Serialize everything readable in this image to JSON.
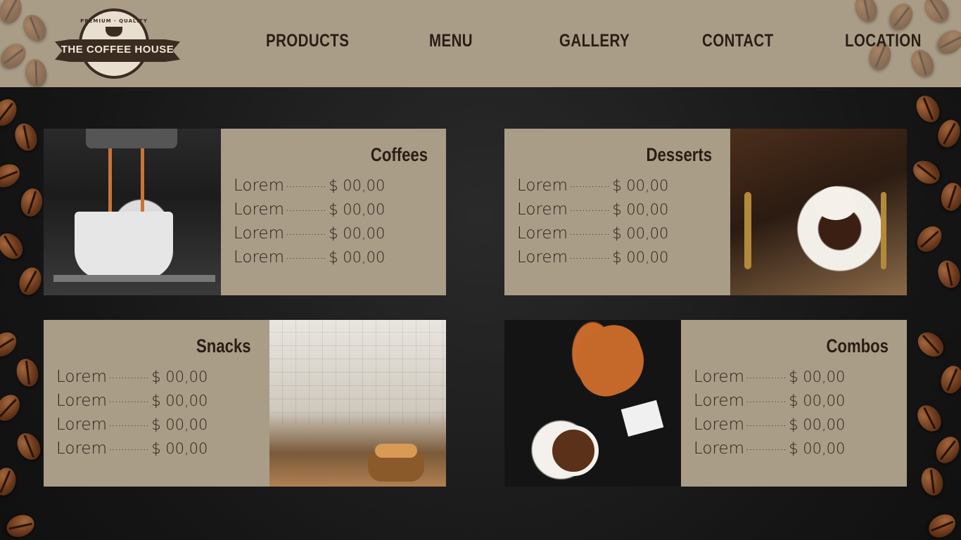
{
  "header": {
    "logo": {
      "small_text": "PREMIUM · QUALITY",
      "name": "THE COFFEE HOUSE"
    },
    "nav": [
      "PRODUCTS",
      "MENU",
      "GALLERY",
      "CONTACT",
      "LOCATION"
    ]
  },
  "cards": [
    {
      "title": "Coffees",
      "image": "espresso-machine-cup-image",
      "items": [
        {
          "name": "Lorem",
          "dots": "·············",
          "price": "$ 00,00"
        },
        {
          "name": "Lorem",
          "dots": "·············",
          "price": "$ 00,00"
        },
        {
          "name": "Lorem",
          "dots": "·············",
          "price": "$ 00,00"
        },
        {
          "name": "Lorem",
          "dots": "·············",
          "price": "$ 00,00"
        }
      ]
    },
    {
      "title": "Desserts",
      "image": "chocolate-dessert-image",
      "items": [
        {
          "name": "Lorem",
          "dots": "·············",
          "price": "$ 00,00"
        },
        {
          "name": "Lorem",
          "dots": "·············",
          "price": "$ 00,00"
        },
        {
          "name": "Lorem",
          "dots": "·············",
          "price": "$ 00,00"
        },
        {
          "name": "Lorem",
          "dots": "·············",
          "price": "$ 00,00"
        }
      ]
    },
    {
      "title": "Snacks",
      "image": "bakery-counter-image",
      "items": [
        {
          "name": "Lorem",
          "dots": "·············",
          "price": "$ 00,00"
        },
        {
          "name": "Lorem",
          "dots": "·············",
          "price": "$ 00,00"
        },
        {
          "name": "Lorem",
          "dots": "·············",
          "price": "$ 00,00"
        },
        {
          "name": "Lorem",
          "dots": "·············",
          "price": "$ 00,00"
        }
      ]
    },
    {
      "title": "Combos",
      "image": "croissant-coffee-image",
      "items": [
        {
          "name": "Lorem",
          "dots": "·············",
          "price": "$ 00,00"
        },
        {
          "name": "Lorem",
          "dots": "·············",
          "price": "$ 00,00"
        },
        {
          "name": "Lorem",
          "dots": "·············",
          "price": "$ 00,00"
        },
        {
          "name": "Lorem",
          "dots": "·············",
          "price": "$ 00,00"
        }
      ]
    }
  ],
  "colors": {
    "card_bg": "#a99d88",
    "text_dark": "#2b1d14",
    "page_bg": "#1c1c1c"
  }
}
